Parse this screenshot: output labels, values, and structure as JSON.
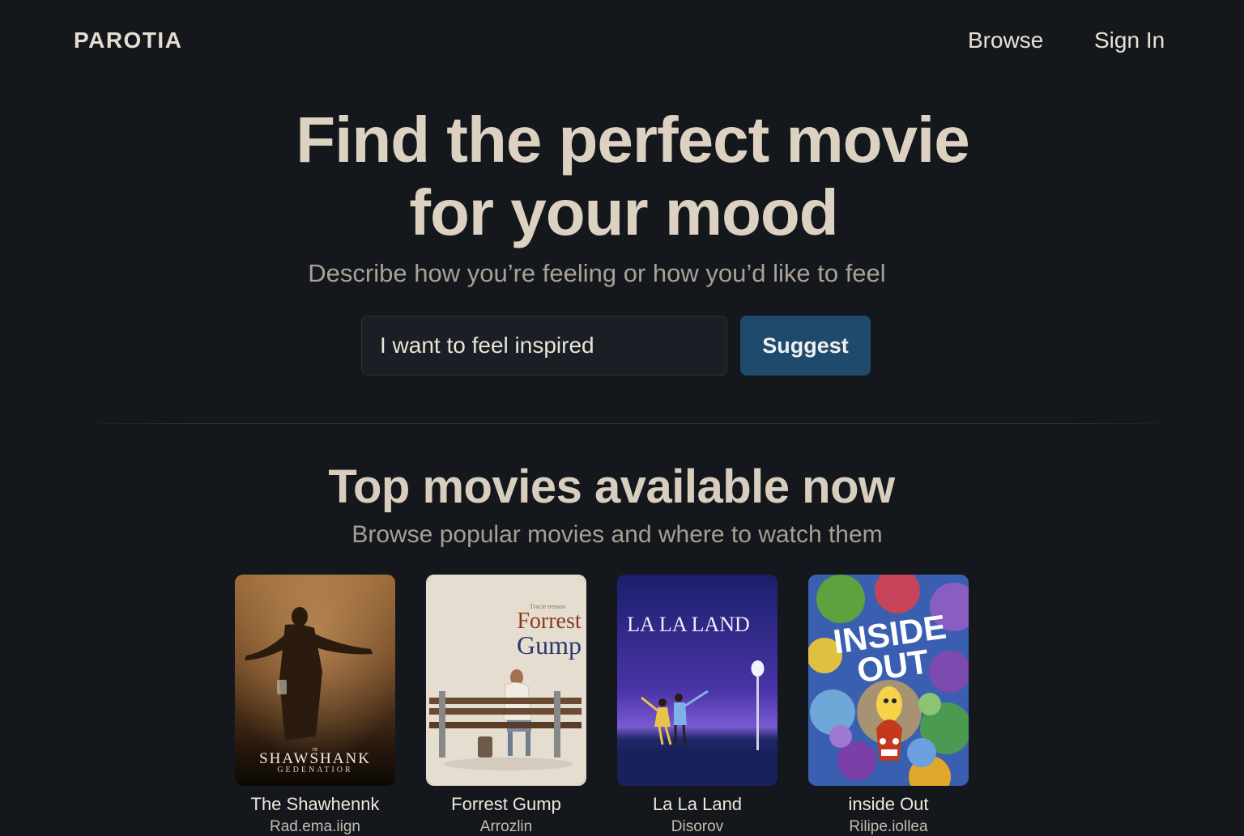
{
  "brand": {
    "logo": "PAROTIA"
  },
  "nav": {
    "browse": "Browse",
    "sign_in": "Sign In"
  },
  "hero": {
    "title_line1": "Find the perfect movie",
    "title_line2": "for your mood",
    "subtitle": "Describe how you’re feeling or how you’d like to feel",
    "input_value": "I want to feel inspired",
    "button_label": "Suggest"
  },
  "section": {
    "title": "Top movies available now",
    "subtitle": "Browse popular movies and where to watch them"
  },
  "movies": [
    {
      "title": "The Shawhennk",
      "provider": "Rad.ema.iign",
      "poster_text": "SHAWSHANK",
      "poster_subtext": "GEDENATIOR",
      "poster_small": "re",
      "poster_icon": "man-in-rain-icon"
    },
    {
      "title": "Forrest Gump",
      "provider": "Arrozlin",
      "poster_small": "Tracie tressos",
      "poster_text_1": "Forrest",
      "poster_text_2": "Gump",
      "poster_icon": "bench-icon"
    },
    {
      "title": "La La Land",
      "provider": "Disorov",
      "poster_text": "LA LA LAND",
      "poster_icon": "dancers-icon"
    },
    {
      "title": "inside Out",
      "provider": "Rilipe.iollea",
      "poster_text_1": "INSIDE",
      "poster_text_2": "OUT",
      "poster_icon": "emotions-icon"
    }
  ],
  "colors": {
    "background": "#14181d",
    "accent_button": "#1f4a6b",
    "heading": "#ddd2c2"
  }
}
